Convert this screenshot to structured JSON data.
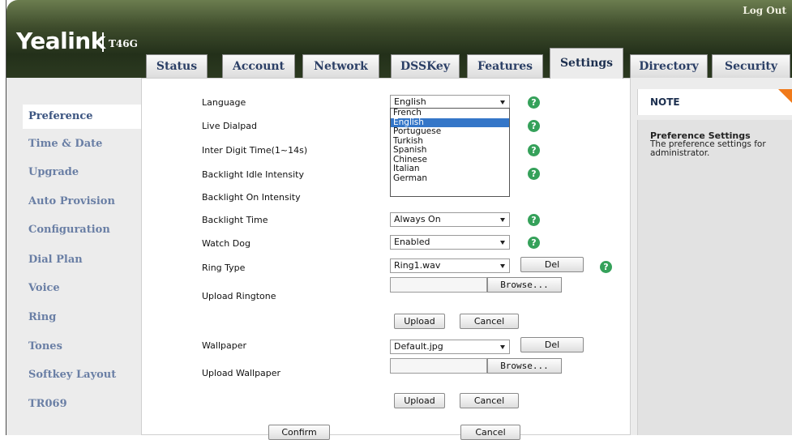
{
  "header": {
    "logo": "Yealink",
    "model": "T46G",
    "logout": "Log Out"
  },
  "tabs": [
    {
      "label": "Status",
      "active": false
    },
    {
      "label": "Account",
      "active": false
    },
    {
      "label": "Network",
      "active": false
    },
    {
      "label": "DSSKey",
      "active": false
    },
    {
      "label": "Features",
      "active": false
    },
    {
      "label": "Settings",
      "active": true
    },
    {
      "label": "Directory",
      "active": false
    },
    {
      "label": "Security",
      "active": false
    }
  ],
  "sidebar": {
    "items": [
      {
        "label": "Preference",
        "active": true
      },
      {
        "label": "Time & Date"
      },
      {
        "label": "Upgrade"
      },
      {
        "label": "Auto Provision"
      },
      {
        "label": "Configuration"
      },
      {
        "label": "Dial Plan"
      },
      {
        "label": "Voice"
      },
      {
        "label": "Ring"
      },
      {
        "label": "Tones"
      },
      {
        "label": "Softkey Layout"
      },
      {
        "label": "TR069"
      }
    ]
  },
  "form": {
    "language_label": "Language",
    "language_value": "English",
    "language_options": [
      "French",
      "English",
      "Portuguese",
      "Turkish",
      "Spanish",
      "Chinese",
      "Italian",
      "German"
    ],
    "live_dialpad_label": "Live Dialpad",
    "inter_digit_label": "Inter Digit Time(1~14s)",
    "backlight_idle_label": "Backlight Idle Intensity",
    "backlight_on_label": "Backlight On Intensity",
    "backlight_time_label": "Backlight Time",
    "backlight_time_value": "Always On",
    "watch_dog_label": "Watch Dog",
    "watch_dog_value": "Enabled",
    "ring_type_label": "Ring Type",
    "ring_type_value": "Ring1.wav",
    "del_label": "Del",
    "upload_ringtone_label": "Upload Ringtone",
    "browse_label": "Browse...",
    "upload_label": "Upload",
    "cancel_label": "Cancel",
    "wallpaper_label": "Wallpaper",
    "wallpaper_value": "Default.jpg",
    "upload_wallpaper_label": "Upload Wallpaper",
    "confirm_label": "Confirm",
    "help_glyph": "?"
  },
  "note": {
    "title": "NOTE",
    "heading": "Preference Settings",
    "text": "The preference settings for administrator."
  }
}
